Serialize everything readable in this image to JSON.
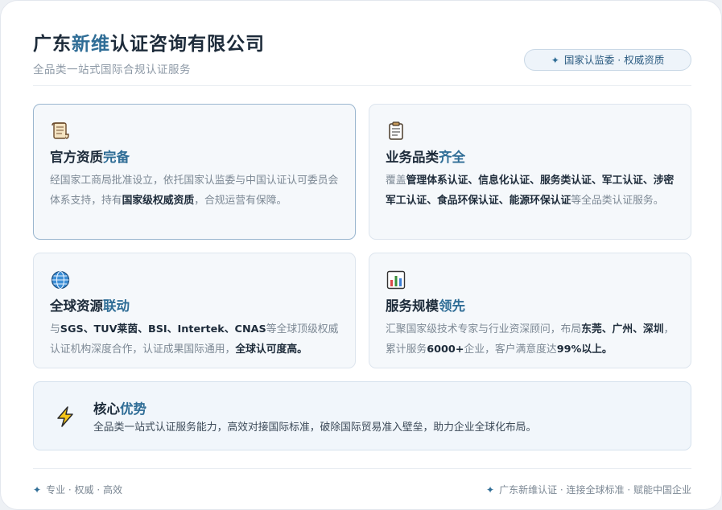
{
  "header": {
    "title_pre": "广东",
    "title_hl": "新维",
    "title_post": "认证咨询有限公司",
    "subtitle": "全品类一站式国际合规认证服务",
    "badge_icon": "sparkle-icon",
    "badge": "国家认监委 · 权威资质"
  },
  "cards": [
    {
      "icon": "scroll-icon",
      "title_pre": "官方资质",
      "title_hl": "完备",
      "text_1": "经国家工商局批准设立，依托国家认监委与中国认证认可委员会体系支持，持有",
      "bold_1": "国家级权威资质",
      "text_2": "，合规运营有保障。"
    },
    {
      "icon": "clipboard-icon",
      "title_pre": "业务品类",
      "title_hl": "齐全",
      "text_1": "覆盖",
      "bold_1": "管理体系认证、信息化认证、服务类认证、军工认证、涉密军工认证、食品环保认证、能源环保认证",
      "text_2": "等全品类认证服务。"
    },
    {
      "icon": "globe-icon",
      "title_pre": "全球资源",
      "title_hl": "联动",
      "text_1": "与",
      "bold_1": "SGS、TUV莱茵、BSI、Intertek、CNAS",
      "text_2": "等全球顶级权威认证机构深度合作，认证成果国际通用，",
      "bold_2": "全球认可度高。"
    },
    {
      "icon": "bar-chart-icon",
      "title_pre": "服务规模",
      "title_hl": "领先",
      "text_1": "汇聚国家级技术专家与行业资深顾问，布局",
      "bold_1": "东莞、广州、深圳",
      "text_2": "，累计服务",
      "bold_2": "6000+",
      "text_3": "企业，客户满意度达",
      "bold_3": "99%以上。"
    }
  ],
  "core": {
    "icon": "lightning-icon",
    "title_pre": "核心",
    "title_hl": "优势",
    "text": "全品类一站式认证服务能力，高效对接国际标准，破除国际贸易准入壁垒，助力企业全球化布局。"
  },
  "footer": {
    "left": "专业 · 权威 · 高效",
    "right": "广东新维认证 · 连接全球标准 · 赋能中国企业"
  },
  "colors": {
    "accent": "#2f6d96",
    "text": "#1d2b3a",
    "muted": "#7c8894",
    "card_bg": "#f5f8fb"
  }
}
